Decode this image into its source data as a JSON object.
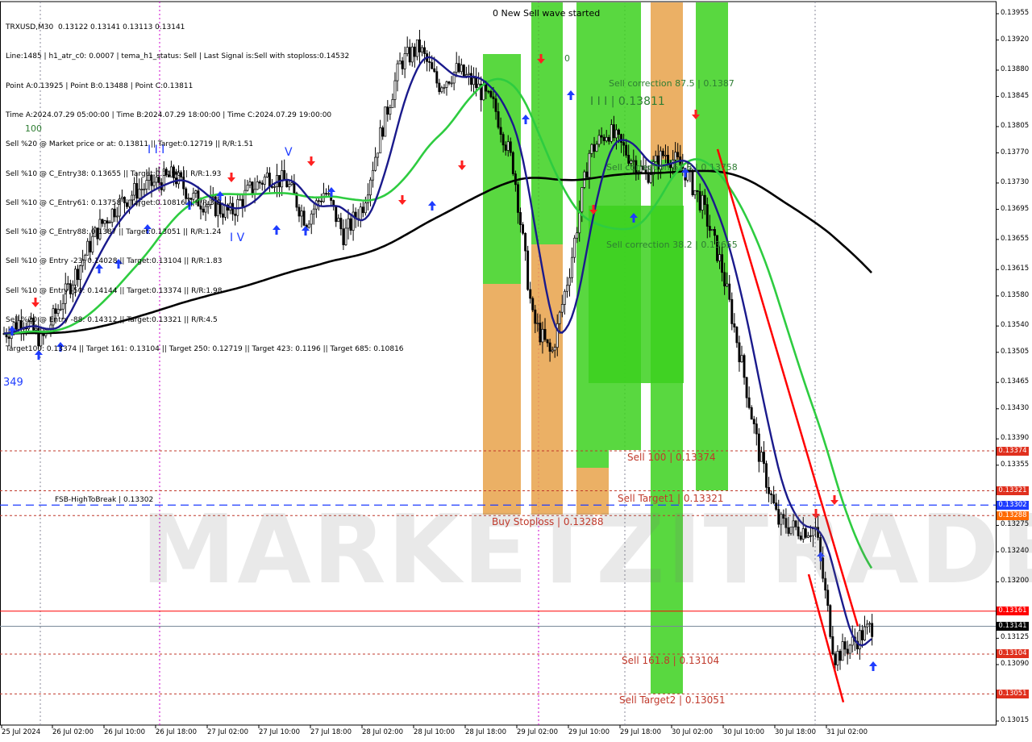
{
  "header": {
    "symbol_line": "TRXUSD,M30  0.13122 0.13141 0.13113 0.13141",
    "info_lines": [
      "Line:1485 | h1_atr_c0: 0.0007 | tema_h1_status: Sell | Last Signal is:Sell with stoploss:0.14532",
      "Point A:0.13925 | Point B:0.13488 | Point C:0.13811",
      "Time A:2024.07.29 05:00:00 | Time B:2024.07.29 18:00:00 | Time C:2024.07.29 19:00:00",
      "Sell %20 @ Market price or at: 0.13811 || Target:0.12719 || R/R:1.51",
      "Sell %10 @ C_Entry38: 0.13655 || Target:0.1196 || R/R:1.93",
      "Sell %10 @ C_Entry61: 0.13758 || Target:0.10816 || R/R:3.8",
      "Sell %10 @ C_Entry88: 0.1387 || Target:0.13051 || R/R:1.24",
      "Sell %10 @ Entry -23: 0.14028 || Target:0.13104 || R/R:1.83",
      "Sell %10 @ Entry -50: 0.14144 || Target:0.13374 || R/R:1.98",
      "Sell %20 @ Entry -88: 0.14312 || Target:0.13321 || R/R:4.5",
      "Target100: 0.13374 || Target 161: 0.13104 || Target 250: 0.12719 || Target 423: 0.1196 || Target 685: 0.10816"
    ]
  },
  "watermark": "MARKETZITRADE",
  "annotations": {
    "new_wave": "0 New Sell wave started",
    "sell_correction_875": "Sell correction 87.5 | 0.1387",
    "point_c": "I I I | 0.13811",
    "sell_correction_618": "Sell correction 61.8 | 0.13758",
    "sell_correction_382": "Sell correction 38.2 | 0.13655",
    "sell_100": "Sell 100 | 0.13374",
    "sell_target1": "Sell Target1 | 0.13321",
    "buy_stoploss": "Buy Stoploss | 0.13288",
    "fsb": "FSB-HighToBreak | 0.13302",
    "sell_1618": "Sell 161.8 | 0.13104",
    "sell_target2": "Sell Target2 | 0.13051",
    "wave_iii": "I I I",
    "wave_v": "V",
    "wave_iv": "I V",
    "label_100": "100",
    "label_349": "349",
    "label_0": "0"
  },
  "price_axis": {
    "ticks": [
      "0.13955",
      "0.13920",
      "0.13880",
      "0.13845",
      "0.13805",
      "0.13770",
      "0.13730",
      "0.13695",
      "0.13655",
      "0.13615",
      "0.13580",
      "0.13540",
      "0.13505",
      "0.13465",
      "0.13430",
      "0.13390",
      "0.13355",
      "0.13275",
      "0.13240",
      "0.13200",
      "0.13125",
      "0.13090",
      "0.13015"
    ],
    "tags": [
      {
        "label": "0.13374",
        "price": 0.13374,
        "color": "#e0301e"
      },
      {
        "label": "0.13321",
        "price": 0.13321,
        "color": "#e0301e"
      },
      {
        "label": "0.13302",
        "price": 0.13302,
        "color": "#1e3cff"
      },
      {
        "label": "0.13288",
        "price": 0.13288,
        "color": "#ff6a00"
      },
      {
        "label": "0.13161",
        "price": 0.13161,
        "color": "#ff0000"
      },
      {
        "label": "0.13141",
        "price": 0.13141,
        "color": "#000000"
      },
      {
        "label": "0.13104",
        "price": 0.13104,
        "color": "#e0301e"
      },
      {
        "label": "0.13051",
        "price": 0.13051,
        "color": "#e0301e"
      }
    ]
  },
  "time_axis": {
    "labels": [
      "25 Jul 2024",
      "26 Jul 02:00",
      "26 Jul 10:00",
      "26 Jul 18:00",
      "27 Jul 02:00",
      "27 Jul 10:00",
      "27 Jul 18:00",
      "28 Jul 02:00",
      "28 Jul 10:00",
      "28 Jul 18:00",
      "29 Jul 02:00",
      "29 Jul 10:00",
      "29 Jul 18:00",
      "30 Jul 02:00",
      "30 Jul 10:00",
      "30 Jul 18:00",
      "31 Jul 02:00"
    ]
  },
  "colors": {
    "candle": "#000000",
    "ema_blue": "#1a1a8c",
    "ema_green": "#2ecc40",
    "ma_black": "#000000",
    "zone_green": "#3cd11e",
    "zone_orange": "#e8a24a",
    "trend_red": "#ff0000",
    "level_red": "#c0392b",
    "level_blue": "#1e3cff"
  },
  "chart_data": {
    "type": "candlestick",
    "symbol": "TRXUSD",
    "timeframe": "M30",
    "ohlc_last": {
      "open": 0.13122,
      "high": 0.13141,
      "low": 0.13113,
      "close": 0.13141
    },
    "ylim": [
      0.1301,
      0.13965
    ],
    "x_labels": [
      "25 Jul 2024",
      "26 Jul 02:00",
      "26 Jul 10:00",
      "26 Jul 18:00",
      "27 Jul 02:00",
      "27 Jul 10:00",
      "27 Jul 18:00",
      "28 Jul 02:00",
      "28 Jul 10:00",
      "28 Jul 18:00",
      "29 Jul 02:00",
      "29 Jul 10:00",
      "29 Jul 18:00",
      "30 Jul 02:00",
      "30 Jul 10:00",
      "30 Jul 18:00",
      "31 Jul 02:00"
    ],
    "close_path": [
      0.1353,
      0.1355,
      0.1352,
      0.1357,
      0.1362,
      0.1367,
      0.137,
      0.1372,
      0.1373,
      0.1374,
      0.1371,
      0.137,
      0.1369,
      0.1372,
      0.1374,
      0.1373,
      0.1368,
      0.1372,
      0.1366,
      0.137,
      0.138,
      0.1389,
      0.1391,
      0.1386,
      0.1388,
      0.1386,
      0.1383,
      0.1375,
      0.1355,
      0.135,
      0.1362,
      0.1377,
      0.138,
      0.1377,
      0.1374,
      0.1377,
      0.1375,
      0.137,
      0.1362,
      0.135,
      0.1337,
      0.1328,
      0.1327,
      0.1327,
      0.131,
      0.1312,
      0.13141
    ],
    "levels": [
      {
        "name": "Sell 100",
        "value": 0.13374
      },
      {
        "name": "Sell Target1",
        "value": 0.13321
      },
      {
        "name": "FSB-HighToBreak",
        "value": 0.13302
      },
      {
        "name": "Buy Stoploss",
        "value": 0.13288
      },
      {
        "name": "Sell 161.8",
        "value": 0.13104
      },
      {
        "name": "Sell Target2",
        "value": 0.13051
      }
    ],
    "points": {
      "A": 0.13925,
      "B": 0.13488,
      "C": 0.13811
    }
  }
}
